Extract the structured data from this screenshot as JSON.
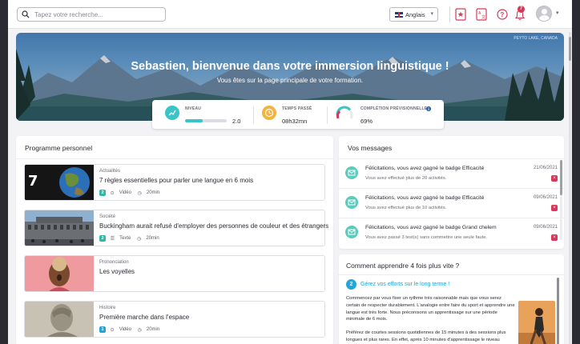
{
  "search": {
    "placeholder": "Tapez votre recherche..."
  },
  "language": {
    "selected": "Anglais"
  },
  "notifications": {
    "count": "7"
  },
  "hero": {
    "credit": "PEYTO LAKE, CANADA",
    "title": "Sebastien, bienvenue dans votre immersion linguistique !",
    "subtitle": "Vous êtes sur la page principale de votre formation."
  },
  "stats": {
    "level": {
      "label": "NIVEAU",
      "value": "2.0",
      "progress": 0.42
    },
    "time": {
      "label": "TEMPS PASSÉ",
      "value": "08h32mn"
    },
    "completion": {
      "label": "COMPLÉTION PRÉVISIONNELLE",
      "value": "69%",
      "percent": 69
    }
  },
  "program": {
    "title": "Programme personnel",
    "courses": [
      {
        "category": "Actualités",
        "title": "7 règles essentielles pour parler une langue en 6 mois",
        "level": "2",
        "level_color": "#2fb7a8",
        "type": "Vidéo",
        "duration": "20min"
      },
      {
        "category": "Société",
        "title": "Buckingham aurait refusé d'employer des personnes de couleur et des étrangers",
        "level": "2",
        "level_color": "#2fb7a8",
        "type": "Texte",
        "duration": "20min"
      },
      {
        "category": "Prononciation",
        "title": "Les voyelles",
        "level": "",
        "level_color": "",
        "type": "",
        "duration": ""
      },
      {
        "category": "Histoire",
        "title": "Première marche dans l'espace",
        "level": "1",
        "level_color": "#22a5d8",
        "type": "Vidéo",
        "duration": "20min"
      }
    ]
  },
  "messages": {
    "title": "Vos messages",
    "items": [
      {
        "title": "Félicitations, vous avez gagné le badge Efficacité",
        "subtitle": "Vous avez effectué plus de 20 activités.",
        "date": "21/06/2021"
      },
      {
        "title": "Félicitations, vous avez gagné le badge Efficacité",
        "subtitle": "Vous avez effectué plus de 10 activités.",
        "date": "09/06/2021"
      },
      {
        "title": "Félicitations, vous avez gagné le badge Grand chelem",
        "subtitle": "Vous avez passé 3 test(s) sans commettre une seule faute.",
        "date": "09/06/2021"
      }
    ]
  },
  "tips": {
    "title": "Comment apprendre 4 fois plus vite ?",
    "number": "2",
    "heading": "Gérez vos efforts sur le long terme !",
    "paragraph1": "Commencez par vous fixer un rythme très raisonnable mais que vous serez certain de respecter durablement. L'analogie entre faire du sport et apprendre une langue est très forte. Nous préconisons un apprentissage sur une période minimale de 6 mois.",
    "paragraph2": "Préférez de courtes sessions quotidiennes de 15 minutes à des sessions plus longues et plus rares. En effet, après 10 minutes d'apprentissage le niveau"
  },
  "colors": {
    "accent": "#38c4c8",
    "danger": "#d9375a",
    "blue": "#22a5d8"
  }
}
